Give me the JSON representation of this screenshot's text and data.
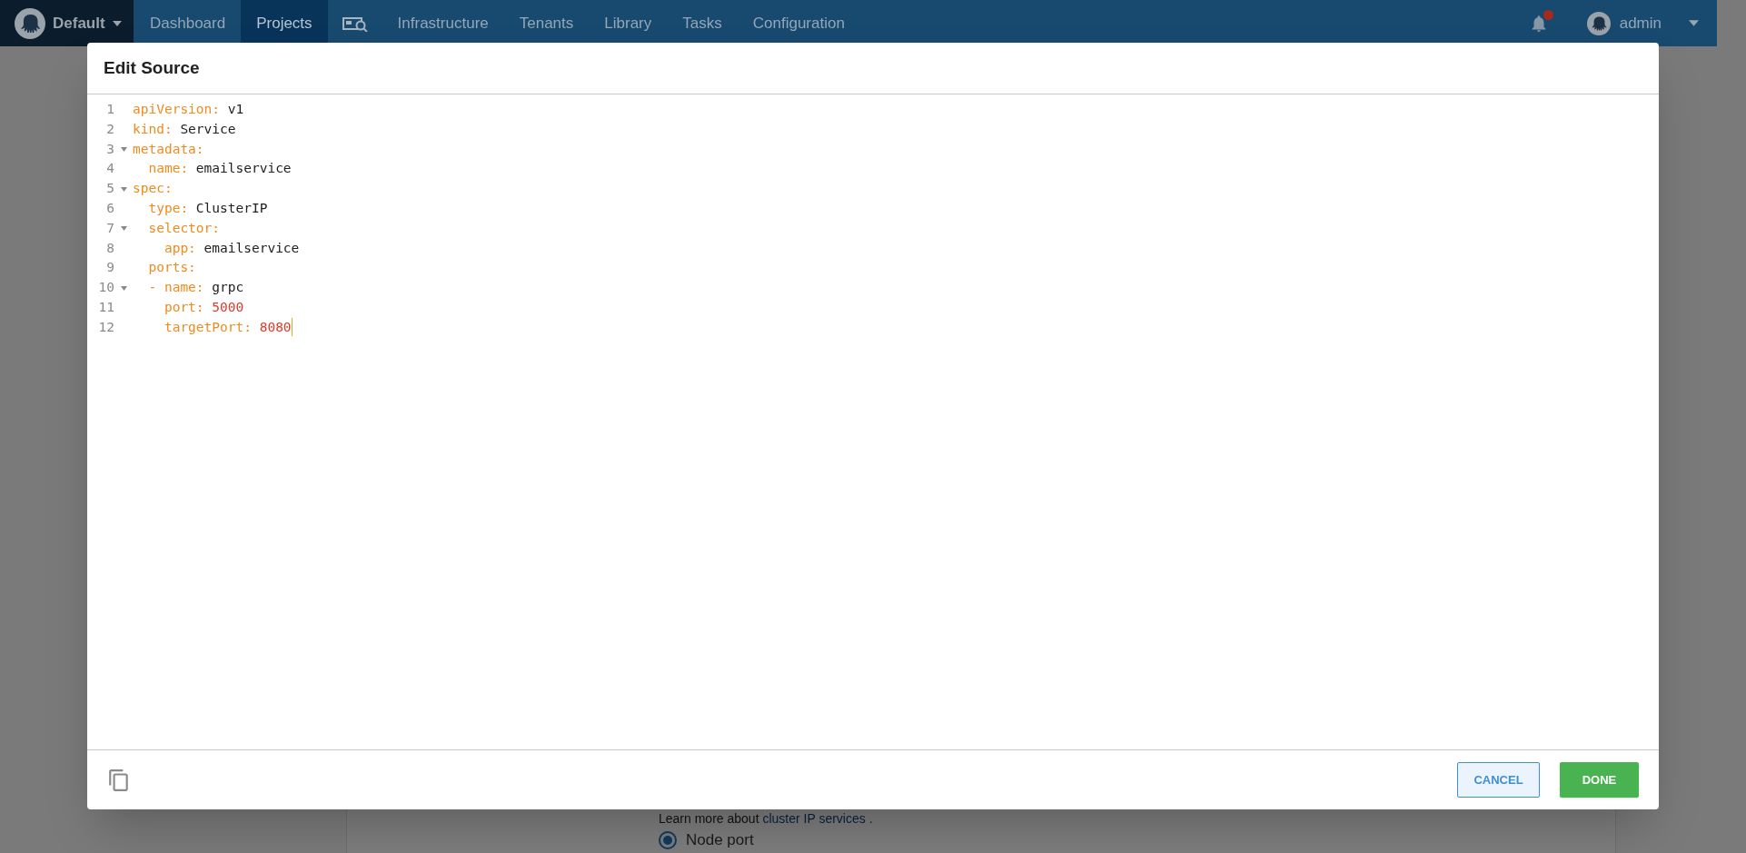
{
  "nav": {
    "space": "Default",
    "items": [
      {
        "label": "Dashboard",
        "kind": "text",
        "selected": false
      },
      {
        "label": "Projects",
        "kind": "text",
        "selected": true
      },
      {
        "kind": "icon",
        "selected": false
      },
      {
        "label": "Infrastructure",
        "kind": "text",
        "selected": false
      },
      {
        "label": "Tenants",
        "kind": "text",
        "selected": false
      },
      {
        "label": "Library",
        "kind": "text",
        "selected": false
      },
      {
        "label": "Tasks",
        "kind": "text",
        "selected": false
      },
      {
        "label": "Configuration",
        "kind": "text",
        "selected": false
      }
    ],
    "notifications": true,
    "user": "admin"
  },
  "dialog": {
    "title": "Edit Source",
    "lines": [
      {
        "number": "1",
        "foldable": false,
        "key": "apiVersion:",
        "value": " v1",
        "kind": "string"
      },
      {
        "number": "2",
        "foldable": false,
        "key": "kind:",
        "value": " Service",
        "kind": "string"
      },
      {
        "number": "3",
        "foldable": true,
        "key": "metadata:"
      },
      {
        "number": "4",
        "foldable": false,
        "key": "  name:",
        "value": " emailservice",
        "kind": "string"
      },
      {
        "number": "5",
        "foldable": true,
        "key": "spec:"
      },
      {
        "number": "6",
        "foldable": false,
        "key": "  type:",
        "value": " ClusterIP",
        "kind": "string"
      },
      {
        "number": "7",
        "foldable": true,
        "key": "  selector:"
      },
      {
        "number": "8",
        "foldable": false,
        "key": "    app:",
        "value": " emailservice",
        "kind": "string"
      },
      {
        "number": "9",
        "foldable": false,
        "key": "  ports:"
      },
      {
        "number": "10",
        "foldable": true,
        "key": "  - name:",
        "value": " grpc",
        "kind": "string"
      },
      {
        "number": "11",
        "foldable": false,
        "key": "    port:",
        "value": " 5000",
        "kind": "number"
      },
      {
        "number": "12",
        "foldable": false,
        "key": "    targetPort:",
        "value": " 8080",
        "kind": "number",
        "cursor": true
      }
    ],
    "buttons": [
      {
        "label": "CANCEL",
        "kind": "secondary"
      },
      {
        "label": "DONE",
        "kind": "primary"
      }
    ]
  },
  "background": {
    "note_prefix": "Learn more about ",
    "note_link": "cluster IP services",
    "note_suffix": " .",
    "radio": {
      "label": "Node port",
      "selected": true
    }
  }
}
